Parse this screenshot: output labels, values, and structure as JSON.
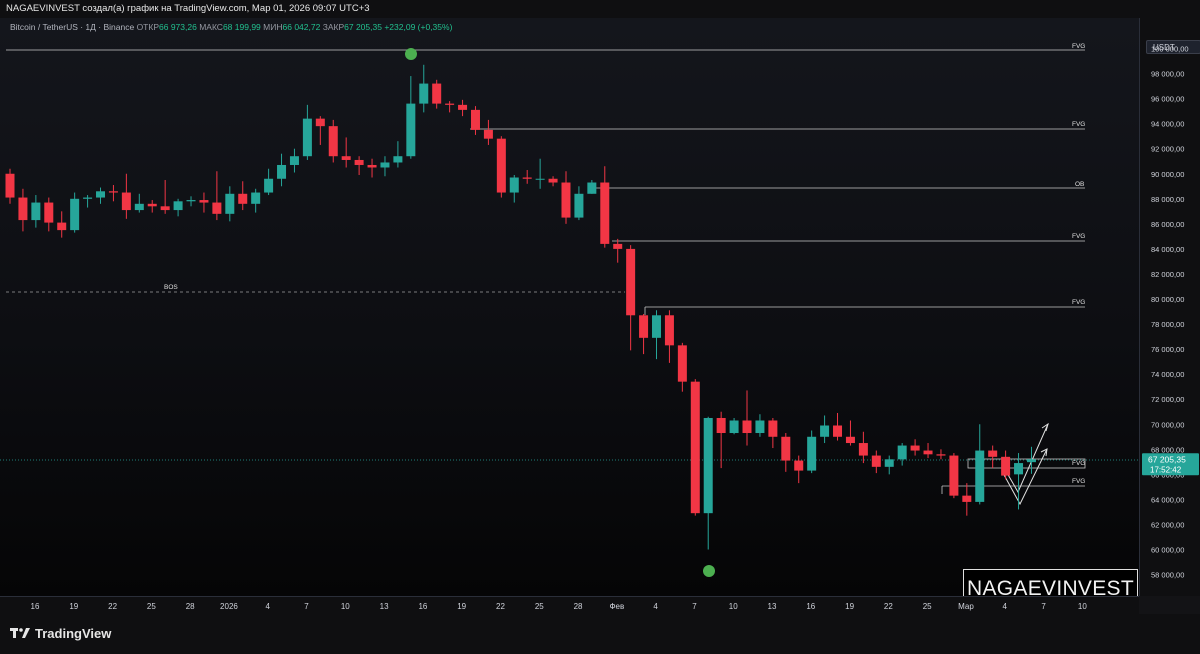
{
  "header": {
    "title": "NAGAEVINVEST создал(а) график на TradingView.com, Мар 01, 2026 09:07 UTC+3"
  },
  "legend": {
    "symbol": "Bitcoin / TetherUS · 1Д · Binance",
    "open_label": "ОТКР",
    "open_value": "66 973,26",
    "high_label": "МАКС",
    "high_value": "68 199,99",
    "low_label": "МИН",
    "low_value": "66 042,72",
    "close_label": "ЗАКР",
    "close_value": "67 205,35",
    "change": "+232,09 (+0,35%)"
  },
  "currency_button": "USDT",
  "price_axis": {
    "labels": [
      "100 000,00",
      "98 000,00",
      "96 000,00",
      "94 000,00",
      "92 000,00",
      "90 000,00",
      "88 000,00",
      "86 000,00",
      "84 000,00",
      "82 000,00",
      "80 000,00",
      "78 000,00",
      "76 000,00",
      "74 000,00",
      "72 000,00",
      "70 000,00",
      "68 000,00",
      "66 000,00",
      "64 000,00",
      "62 000,00",
      "60 000,00",
      "58 000,00"
    ],
    "current_price": "67 205,35",
    "countdown": "17:52:42"
  },
  "time_axis": {
    "labels": [
      "16",
      "19",
      "22",
      "25",
      "28",
      "2026",
      "4",
      "7",
      "10",
      "13",
      "16",
      "19",
      "22",
      "25",
      "28",
      "Фев",
      "4",
      "7",
      "10",
      "13",
      "16",
      "19",
      "22",
      "25",
      "Мар",
      "4",
      "7",
      "10"
    ]
  },
  "annotations": {
    "fvg_1": "FVG",
    "fvg_2": "FVG",
    "ob": "OB",
    "fvg_3": "FVG",
    "fvg_4": "FVG",
    "fvg_5": "FVG",
    "fvg_6": "FVG",
    "bos": "BOS",
    "event_marker": "F"
  },
  "watermark": "NAGAEVINVEST",
  "footer": {
    "brand": "TradingView"
  },
  "colors": {
    "up": "#26a69a",
    "down": "#f23645",
    "background": "#131316",
    "current_price_tag": "#26a69a",
    "marker": "#4caf50",
    "event_marker": "#9c27b0"
  },
  "chart_data": {
    "type": "candlestick",
    "symbol": "BTCUSDT",
    "interval": "1D",
    "ylim": [
      57000,
      101500
    ],
    "y_ticks": [
      58000,
      60000,
      62000,
      64000,
      66000,
      68000,
      70000,
      72000,
      74000,
      76000,
      78000,
      80000,
      82000,
      84000,
      86000,
      88000,
      90000,
      92000,
      94000,
      96000,
      98000,
      100000
    ],
    "x_tick_labels": [
      "16",
      "19",
      "22",
      "25",
      "28",
      "2026",
      "4",
      "7",
      "10",
      "13",
      "16",
      "19",
      "22",
      "25",
      "28",
      "Фев",
      "4",
      "7",
      "10",
      "13",
      "16",
      "19",
      "22",
      "25",
      "Мар",
      "4",
      "7",
      "10"
    ],
    "candles": [
      [
        90000,
        88100,
        90400,
        87600
      ],
      [
        88100,
        86300,
        88800,
        85400
      ],
      [
        86300,
        87700,
        88300,
        85700
      ],
      [
        87700,
        86100,
        88100,
        85400
      ],
      [
        86100,
        85500,
        87000,
        84900
      ],
      [
        85500,
        88000,
        88500,
        85300
      ],
      [
        88000,
        88100,
        88300,
        87300
      ],
      [
        88100,
        88600,
        88900,
        87600
      ],
      [
        88600,
        88500,
        89100,
        87800
      ],
      [
        88500,
        87100,
        90000,
        86400
      ],
      [
        87100,
        87600,
        88400,
        86900
      ],
      [
        87600,
        87400,
        87900,
        86900
      ],
      [
        87400,
        87100,
        89500,
        86800
      ],
      [
        87100,
        87800,
        88000,
        86600
      ],
      [
        87800,
        87900,
        88200,
        87400
      ],
      [
        87900,
        87700,
        88500,
        86900
      ],
      [
        87700,
        86800,
        90200,
        86300
      ],
      [
        86800,
        88400,
        89000,
        86200
      ],
      [
        88400,
        87600,
        89400,
        87100
      ],
      [
        87600,
        88500,
        88800,
        86900
      ],
      [
        88500,
        89600,
        90400,
        88300
      ],
      [
        89600,
        90700,
        91600,
        89000
      ],
      [
        90700,
        91400,
        92000,
        90100
      ],
      [
        91400,
        94400,
        95500,
        91100
      ],
      [
        94400,
        93800,
        94600,
        92300
      ],
      [
        93800,
        91400,
        94300,
        90900
      ],
      [
        91400,
        91100,
        92900,
        90500
      ],
      [
        91100,
        90700,
        91400,
        89900
      ],
      [
        90700,
        90500,
        91200,
        89700
      ],
      [
        90500,
        90900,
        91400,
        89800
      ],
      [
        90900,
        91400,
        92600,
        90500
      ],
      [
        91400,
        95600,
        97800,
        91200
      ],
      [
        95600,
        97200,
        98700,
        94900
      ],
      [
        97200,
        95600,
        97500,
        95200
      ],
      [
        95600,
        95500,
        95800,
        94900
      ],
      [
        95500,
        95100,
        95900,
        94600
      ],
      [
        95100,
        93500,
        95400,
        93100
      ],
      [
        93500,
        92800,
        94300,
        92300
      ],
      [
        92800,
        88500,
        93000,
        88100
      ],
      [
        88500,
        89700,
        89900,
        87700
      ],
      [
        89700,
        89600,
        90300,
        89200
      ],
      [
        89600,
        89600,
        91200,
        88800
      ],
      [
        89600,
        89300,
        89800,
        89000
      ],
      [
        89300,
        86500,
        90200,
        86000
      ],
      [
        86500,
        88400,
        89000,
        86300
      ],
      [
        88400,
        89300,
        89500,
        88400
      ],
      [
        89300,
        84400,
        90600,
        84100
      ],
      [
        84400,
        84000,
        84800,
        82900
      ],
      [
        84000,
        78700,
        84300,
        75900
      ],
      [
        78700,
        76900,
        78800,
        75600
      ],
      [
        76900,
        78700,
        79100,
        75200
      ],
      [
        78700,
        76300,
        79100,
        74900
      ],
      [
        76300,
        73400,
        76500,
        72600
      ],
      [
        73400,
        62900,
        73600,
        62700
      ],
      [
        62900,
        70500,
        70600,
        60000
      ],
      [
        70500,
        69300,
        71000,
        66500
      ],
      [
        69300,
        70300,
        70500,
        69200
      ],
      [
        70300,
        69300,
        72700,
        68300
      ],
      [
        69300,
        70300,
        70800,
        69000
      ],
      [
        70300,
        69000,
        70500,
        68100
      ],
      [
        69000,
        67100,
        69300,
        66200
      ],
      [
        67100,
        66300,
        67500,
        65300
      ],
      [
        66300,
        69000,
        69500,
        66100
      ],
      [
        69000,
        69900,
        70700,
        68500
      ],
      [
        69900,
        69000,
        70900,
        68700
      ],
      [
        69000,
        68500,
        70300,
        68300
      ],
      [
        68500,
        67500,
        69400,
        66900
      ],
      [
        67500,
        66600,
        67900,
        66100
      ],
      [
        66600,
        67200,
        67500,
        66000
      ],
      [
        67200,
        68300,
        68500,
        66700
      ],
      [
        68300,
        67900,
        68800,
        67500
      ],
      [
        67900,
        67600,
        68500,
        67300
      ],
      [
        67600,
        67500,
        68000,
        67200
      ],
      [
        67500,
        64300,
        67700,
        64100
      ],
      [
        64300,
        63800,
        65300,
        62700
      ],
      [
        63800,
        67900,
        70000,
        63600
      ],
      [
        67900,
        67400,
        68300,
        66500
      ],
      [
        67400,
        65900,
        67900,
        65600
      ],
      [
        66000,
        66900,
        67700,
        63200
      ],
      [
        66973.26,
        67205.35,
        68199.99,
        66042.72
      ]
    ]
  }
}
